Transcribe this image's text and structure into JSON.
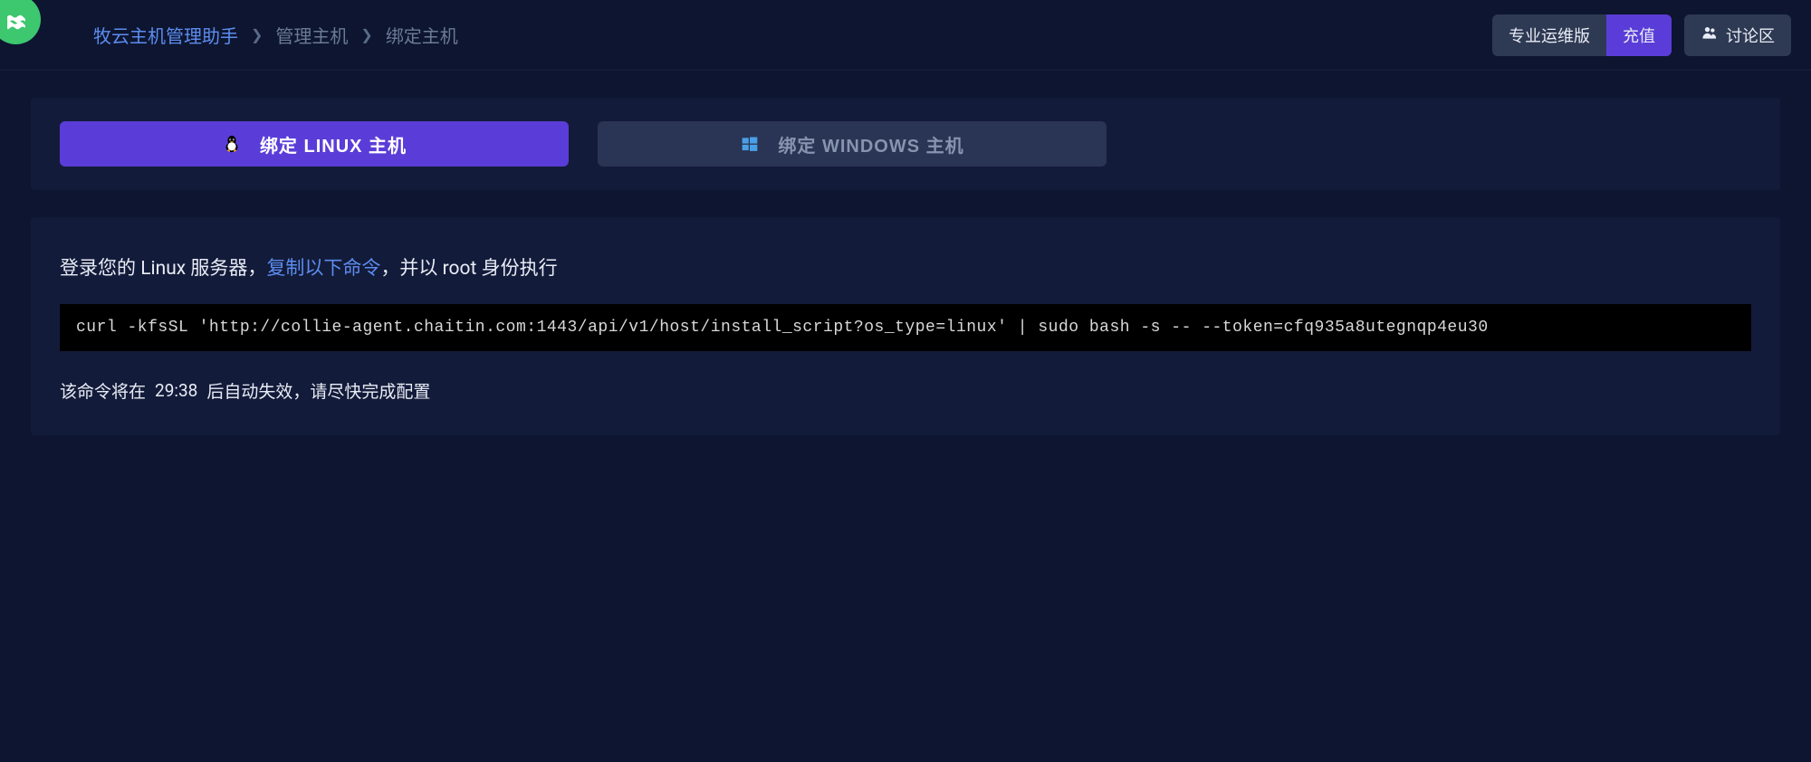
{
  "header": {
    "app_name": "牧云主机管理助手",
    "breadcrumb": [
      "管理主机",
      "绑定主机"
    ],
    "buttons": {
      "pro_label": "专业运维版",
      "recharge_label": "充值",
      "forum_label": "讨论区"
    }
  },
  "tabs": {
    "linux": "绑定 LINUX 主机",
    "windows": "绑定 WINDOWS 主机"
  },
  "instruction": {
    "prefix": "登录您的 Linux 服务器，",
    "link": "复制以下命令",
    "suffix": "，并以 root 身份执行"
  },
  "command": "curl -kfsSL 'http://collie-agent.chaitin.com:1443/api/v1/host/install_script?os_type=linux' | sudo bash -s -- --token=cfq935a8utegnqp4eu30",
  "expire": {
    "prefix": "该命令将在 ",
    "time": "29:38",
    "suffix": " 后自动失效，请尽快完成配置"
  },
  "colors": {
    "background": "#0e1530",
    "panel": "#131b3a",
    "primary": "#5a3dd8",
    "secondary": "#2e3953",
    "link": "#5b8def",
    "logo": "#3dc76f"
  }
}
